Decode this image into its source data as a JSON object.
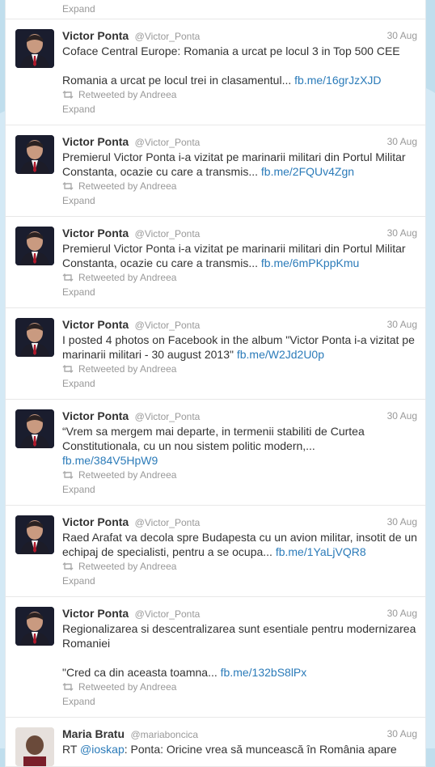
{
  "previous": {
    "expand_label": "Expand"
  },
  "tweets": [
    {
      "name": "Victor Ponta",
      "handle": "@Victor_Ponta",
      "time": "30 Aug",
      "text": "Coface Central Europe: Romania a urcat pe locul 3 in Top 500 CEE\n\nRomania a urcat pe locul trei in clasamentul... ",
      "link": "fb.me/16grJzXJD",
      "retweeted_by": "Retweeted by Andreea",
      "expand_label": "Expand"
    },
    {
      "name": "Victor Ponta",
      "handle": "@Victor_Ponta",
      "time": "30 Aug",
      "text": "Premierul Victor Ponta i-a vizitat pe marinarii militari din Portul Militar Constanta, ocazie cu care a transmis... ",
      "link": "fb.me/2FQUv4Zgn",
      "retweeted_by": "Retweeted by Andreea",
      "expand_label": "Expand"
    },
    {
      "name": "Victor Ponta",
      "handle": "@Victor_Ponta",
      "time": "30 Aug",
      "text": "Premierul Victor Ponta i-a vizitat pe marinarii militari din Portul Militar Constanta, ocazie cu care a transmis... ",
      "link": "fb.me/6mPKppKmu",
      "retweeted_by": "Retweeted by Andreea",
      "expand_label": "Expand"
    },
    {
      "name": "Victor Ponta",
      "handle": "@Victor_Ponta",
      "time": "30 Aug",
      "text": "I posted 4 photos on Facebook in the album \"Victor Ponta i-a vizitat pe marinarii militari - 30 august 2013\" ",
      "link": "fb.me/W2Jd2U0p",
      "retweeted_by": "Retweeted by Andreea",
      "expand_label": "Expand"
    },
    {
      "name": "Victor Ponta",
      "handle": "@Victor_Ponta",
      "time": "30 Aug",
      "text": "“Vrem sa mergem mai departe, in termenii stabiliti de Curtea Constitutionala, cu un nou sistem politic modern,...\n",
      "link": "fb.me/384V5HpW9",
      "retweeted_by": "Retweeted by Andreea",
      "expand_label": "Expand"
    },
    {
      "name": "Victor Ponta",
      "handle": "@Victor_Ponta",
      "time": "30 Aug",
      "text": "Raed Arafat va decola spre Budapesta cu un avion militar, insotit de un echipaj de specialisti, pentru a se ocupa... ",
      "link": "fb.me/1YaLjVQR8",
      "retweeted_by": "Retweeted by Andreea",
      "expand_label": "Expand"
    },
    {
      "name": "Victor Ponta",
      "handle": "@Victor_Ponta",
      "time": "30 Aug",
      "text": "Regionalizarea si descentralizarea sunt esentiale pentru modernizarea Romaniei\n\n\"Cred ca din aceasta toamna... ",
      "link": "fb.me/132bS8lPx",
      "retweeted_by": "Retweeted by Andreea",
      "expand_label": "Expand"
    }
  ],
  "last": {
    "name": "Maria Bratu",
    "handle": "@mariaboncica",
    "time": "30 Aug",
    "text_prefix": "RT ",
    "mention": "@ioskap",
    "text": ": Ponta: Oricine vrea să muncească în România apare"
  },
  "colors": {
    "link": "#2b7bb9",
    "background": "#c0deed",
    "name": "#333333",
    "meta": "#999999"
  }
}
